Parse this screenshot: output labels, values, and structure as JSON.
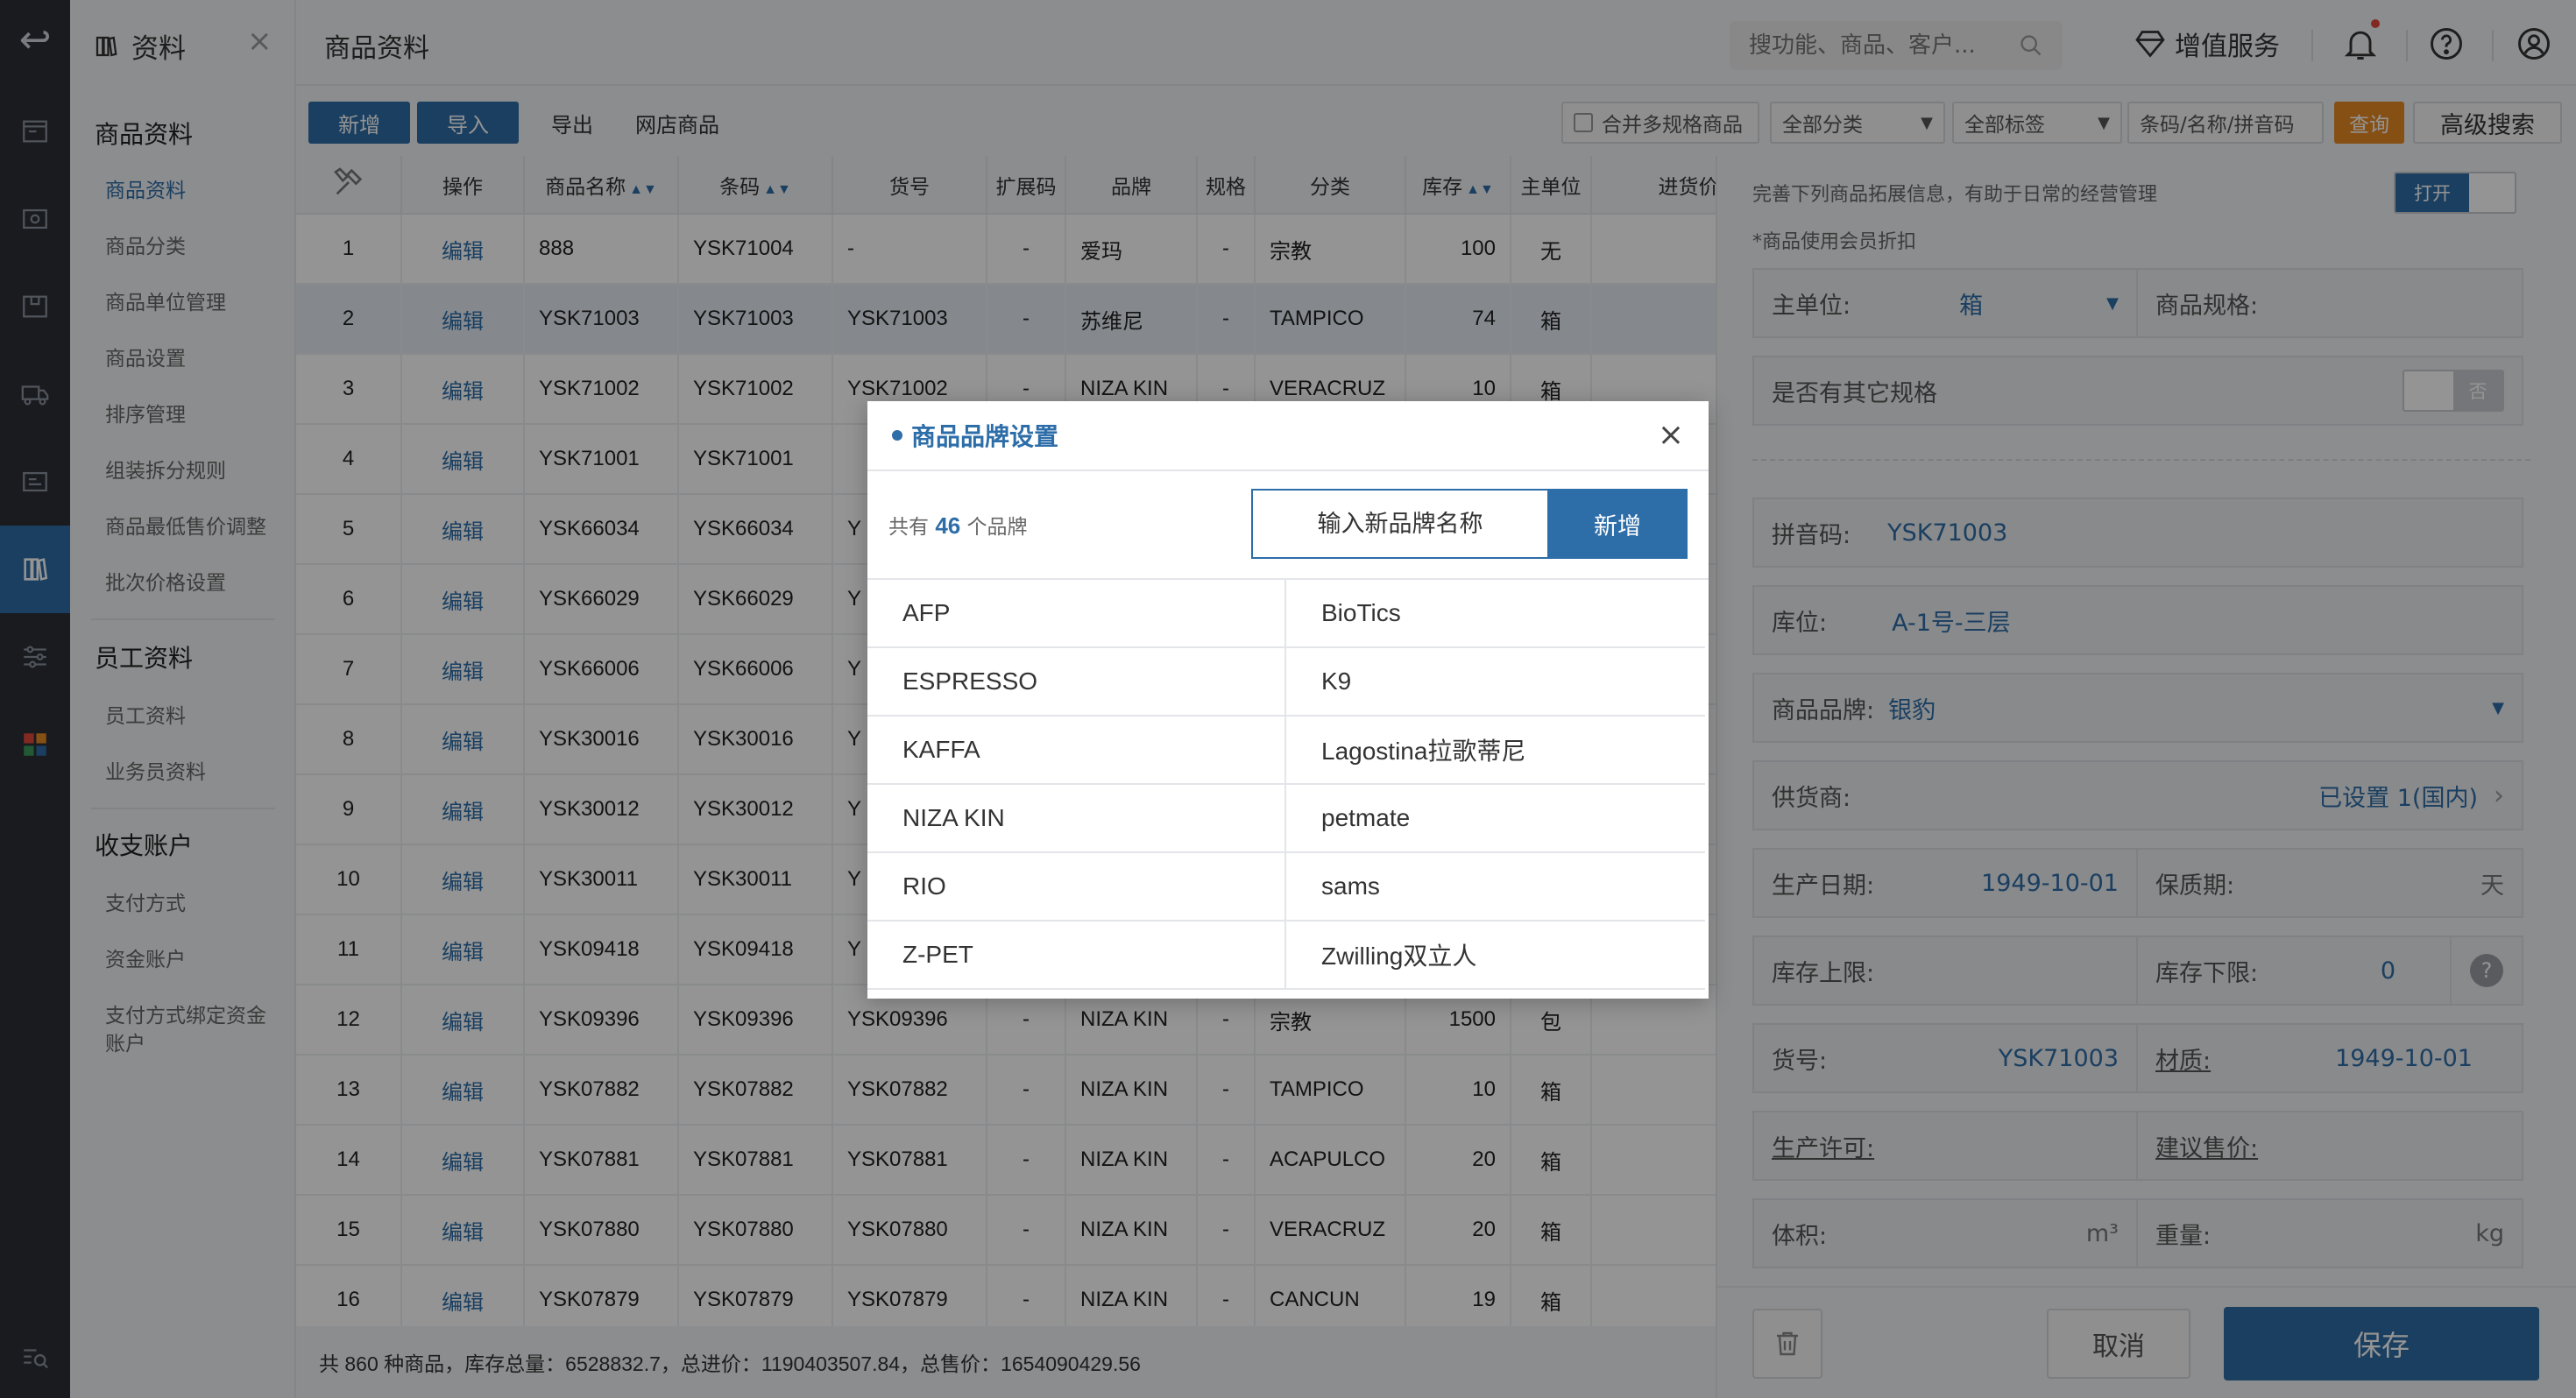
{
  "menu": {
    "header": "资料",
    "groups": [
      {
        "title": "商品资料",
        "items": [
          "商品资料",
          "商品分类",
          "商品单位管理",
          "商品设置",
          "排序管理",
          "组装拆分规则",
          "商品最低售价调整",
          "批次价格设置"
        ]
      },
      {
        "title": "员工资料",
        "items": [
          "员工资料",
          "业务员资料"
        ]
      },
      {
        "title": "收支账户",
        "items": [
          "支付方式",
          "资金账户",
          "支付方式绑定资金",
          "账户"
        ]
      }
    ],
    "active_item": "商品资料"
  },
  "topbar": {
    "page_title": "商品资料",
    "search_placeholder": "搜功能、商品、客户...",
    "vip_label": "增值服务"
  },
  "toolbar": {
    "new_label": "新增",
    "import_label": "导入",
    "export_label": "导出",
    "online_label": "网店商品",
    "merge_label": "合并多规格商品",
    "category_filter": "全部分类",
    "tag_filter": "全部标签",
    "code_filter": "条码/名称/拼音码",
    "query_label": "查询",
    "advanced_label": "高级搜索"
  },
  "table": {
    "headers": [
      "操作",
      "商品名称",
      "条码",
      "货号",
      "扩展码",
      "品牌",
      "规格",
      "分类",
      "库存",
      "主单位",
      "进货价"
    ],
    "edit_label": "编辑",
    "rows": [
      [
        "1",
        "888",
        "YSK71004",
        "-",
        "-",
        "爱玛",
        "-",
        "宗教",
        "100",
        "无"
      ],
      [
        "2",
        "YSK71003",
        "YSK71003",
        "YSK71003",
        "-",
        "苏维尼",
        "-",
        "TAMPICO",
        "74",
        "箱"
      ],
      [
        "3",
        "YSK71002",
        "YSK71002",
        "YSK71002",
        "-",
        "NIZA KIN",
        "-",
        "VERACRUZ",
        "10",
        "箱"
      ],
      [
        "4",
        "YSK71001",
        "YSK71001",
        "",
        "",
        "",
        "",
        "",
        "",
        ""
      ],
      [
        "5",
        "YSK66034",
        "YSK66034",
        "Y",
        "",
        "",
        "",
        "",
        "",
        ""
      ],
      [
        "6",
        "YSK66029",
        "YSK66029",
        "Y",
        "",
        "",
        "",
        "",
        "",
        ""
      ],
      [
        "7",
        "YSK66006",
        "YSK66006",
        "Y",
        "",
        "",
        "",
        "",
        "",
        ""
      ],
      [
        "8",
        "YSK30016",
        "YSK30016",
        "Y",
        "",
        "",
        "",
        "",
        "",
        ""
      ],
      [
        "9",
        "YSK30012",
        "YSK30012",
        "Y",
        "",
        "",
        "",
        "",
        "",
        ""
      ],
      [
        "10",
        "YSK30011",
        "YSK30011",
        "Y",
        "",
        "",
        "",
        "",
        "",
        ""
      ],
      [
        "11",
        "YSK09418",
        "YSK09418",
        "Y",
        "",
        "",
        "",
        "",
        "",
        ""
      ],
      [
        "12",
        "YSK09396",
        "YSK09396",
        "YSK09396",
        "-",
        "NIZA KIN",
        "-",
        "宗教",
        "1500",
        "包"
      ],
      [
        "13",
        "YSK07882",
        "YSK07882",
        "YSK07882",
        "-",
        "NIZA KIN",
        "-",
        "TAMPICO",
        "10",
        "箱"
      ],
      [
        "14",
        "YSK07881",
        "YSK07881",
        "YSK07881",
        "-",
        "NIZA KIN",
        "-",
        "ACAPULCO",
        "20",
        "箱"
      ],
      [
        "15",
        "YSK07880",
        "YSK07880",
        "YSK07880",
        "-",
        "NIZA KIN",
        "-",
        "VERACRUZ",
        "20",
        "箱"
      ],
      [
        "16",
        "YSK07879",
        "YSK07879",
        "YSK07879",
        "-",
        "NIZA KIN",
        "-",
        "CANCUN",
        "19",
        "箱"
      ]
    ],
    "footer": "共 860 种商品，库存总量：6528832.7，总进价：1190403507.84，总售价：1654090429.56"
  },
  "panel": {
    "note": "完善下列商品拓展信息，有助于日常的经营管理",
    "toggle_on": "打开",
    "member_discount": "*商品使用会员折扣",
    "main_unit_label": "主单位:",
    "main_unit_value": "箱",
    "spec_label": "商品规格:",
    "other_spec_label": "是否有其它规格",
    "toggle_off": "否",
    "pinyin_label": "拼音码:",
    "pinyin_value": "YSK71003",
    "location_label": "库位:",
    "location_value": "A-1号-三层",
    "brand_label": "商品品牌:",
    "brand_value": "银豹",
    "supplier_label": "供货商:",
    "supplier_value": "已设置 1(国内)",
    "mfg_date_label": "生产日期:",
    "mfg_date_value": "1949-10-01",
    "shelf_life_label": "保质期:",
    "shelf_life_unit": "天",
    "stock_upper_label": "库存上限:",
    "stock_lower_label": "库存下限:",
    "stock_lower_value": "0",
    "item_no_label": "货号:",
    "item_no_value": "YSK71003",
    "material_label": "材质:",
    "material_value": "1949-10-01",
    "license_label": "生产许可:",
    "suggest_price_label": "建议售价:",
    "volume_label": "体积:",
    "volume_unit": "m³",
    "weight_label": "重量:",
    "weight_unit": "kg",
    "cancel_label": "取消",
    "save_label": "保存"
  },
  "dialog": {
    "title": "商品品牌设置",
    "count_prefix": "共有",
    "count": "46",
    "count_suffix": "个品牌",
    "input_placeholder": "输入新品牌名称",
    "add_label": "新增",
    "brands": [
      "AFP",
      "BioTics",
      "ESPRESSO",
      "K9",
      "KAFFA",
      "Lagostina拉歌蒂尼",
      "NIZA KIN",
      "petmate",
      "RIO",
      "sams",
      "Z-PET",
      "Zwilling双立人"
    ]
  },
  "colors": {
    "primary": "#2d6da8",
    "accent": "#e78a24",
    "rail": "#2b2f36"
  }
}
